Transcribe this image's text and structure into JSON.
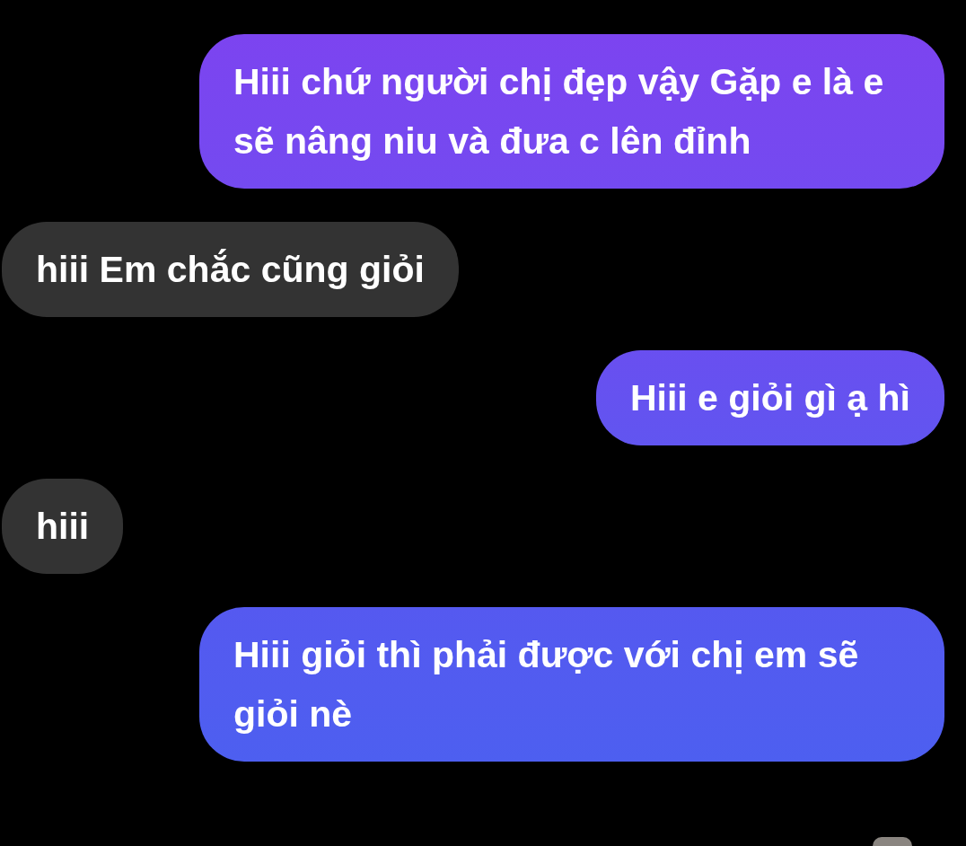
{
  "messages": [
    {
      "kind": "sent",
      "text": "Hiii chứ người chị đẹp vậy Gặp e là e sẽ nâng niu và đưa c lên đỉnh"
    },
    {
      "kind": "received",
      "text": "hiii Em chắc cũng giỏi"
    },
    {
      "kind": "sent",
      "text": "Hiii e giỏi gì ạ hì"
    },
    {
      "kind": "received",
      "text": "hiii"
    },
    {
      "kind": "sent",
      "text": "Hiii giỏi thì phải được với chị em sẽ giỏi nè"
    }
  ]
}
